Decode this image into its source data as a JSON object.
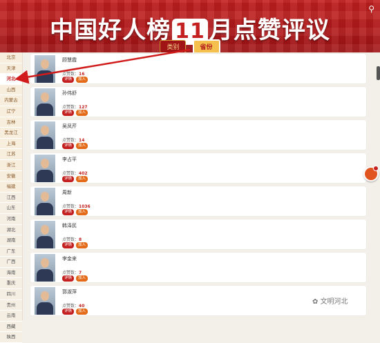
{
  "banner": {
    "title_pre": "中国好人榜",
    "title_num": "11",
    "title_post": "月点赞评议",
    "tab_1": "类别",
    "tab_2": "省份"
  },
  "sidebar": [
    {
      "label": "北京"
    },
    {
      "label": "天津"
    },
    {
      "label": "河北"
    },
    {
      "label": "山西"
    },
    {
      "label": "内蒙古"
    },
    {
      "label": "辽宁"
    },
    {
      "label": "吉林"
    },
    {
      "label": "黑龙江"
    },
    {
      "label": "上海"
    },
    {
      "label": "江苏"
    },
    {
      "label": "浙江"
    },
    {
      "label": "安徽"
    },
    {
      "label": "福建"
    },
    {
      "label": "江西"
    },
    {
      "label": "山东"
    },
    {
      "label": "河南"
    },
    {
      "label": "湖北"
    },
    {
      "label": "湖南"
    },
    {
      "label": "广东"
    },
    {
      "label": "广西"
    },
    {
      "label": "海南"
    },
    {
      "label": "重庆"
    },
    {
      "label": "四川"
    },
    {
      "label": "贵州"
    },
    {
      "label": "云南"
    },
    {
      "label": "西藏"
    },
    {
      "label": "陕西"
    }
  ],
  "cards": [
    {
      "name": "顾慧霞",
      "votes_label": "点赞数：",
      "votes": "16",
      "detail": "详情",
      "join": "加入"
    },
    {
      "name": "孙伟舒",
      "votes_label": "点赞数：",
      "votes": "127",
      "detail": "详情",
      "join": "加入"
    },
    {
      "name": "吴凤芹",
      "votes_label": "点赞数：",
      "votes": "14",
      "detail": "详情",
      "join": "加入"
    },
    {
      "name": "李占平",
      "votes_label": "点赞数：",
      "votes": "402",
      "detail": "详情",
      "join": "加入"
    },
    {
      "name": "周新",
      "votes_label": "点赞数：",
      "votes": "1036",
      "detail": "详情",
      "join": "加入"
    },
    {
      "name": "韩泽民",
      "votes_label": "点赞数：",
      "votes": "8",
      "detail": "详情",
      "join": "加入"
    },
    {
      "name": "李金来",
      "votes_label": "点赞数：",
      "votes": "7",
      "detail": "详情",
      "join": "加入"
    },
    {
      "name": "郭淑萍",
      "votes_label": "点赞数：",
      "votes": "40",
      "detail": "详情",
      "join": "加入"
    }
  ],
  "watermark": "文明河北",
  "colors": {
    "primary": "#c3201f",
    "accent": "#e26a18",
    "gold": "#f5c04d"
  }
}
